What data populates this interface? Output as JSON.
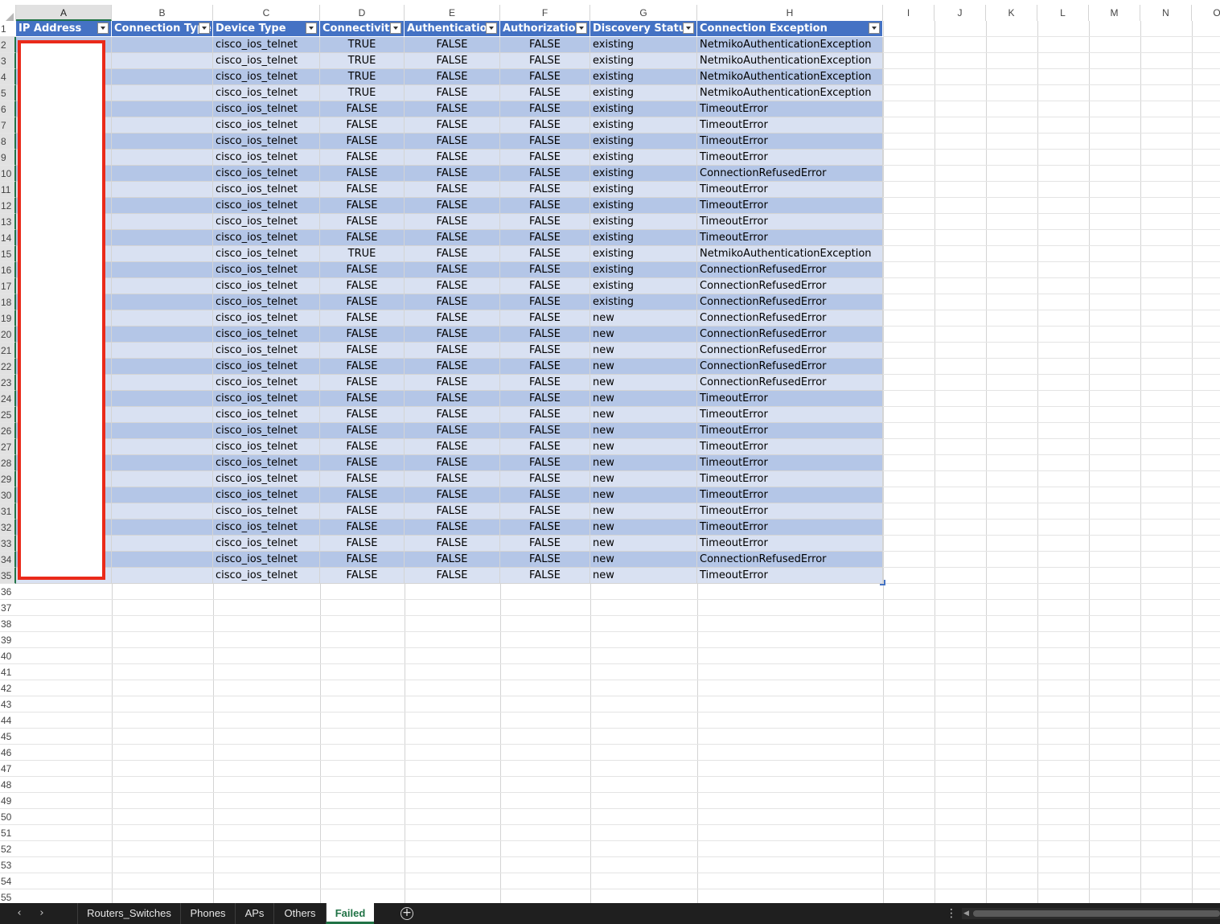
{
  "columns": [
    "A",
    "B",
    "C",
    "D",
    "E",
    "F",
    "G",
    "H",
    "I",
    "J",
    "K",
    "L",
    "M",
    "N",
    "O"
  ],
  "active_column": "A",
  "header_row": [
    "IP Address",
    "Connection Type",
    "Device Type",
    "Connectivity",
    "Authentication",
    "Authorization",
    "Discovery Status",
    "Connection Exception"
  ],
  "rows": [
    [
      "",
      "",
      "cisco_ios_telnet",
      "TRUE",
      "FALSE",
      "FALSE",
      "existing",
      "NetmikoAuthenticationException"
    ],
    [
      "",
      "",
      "cisco_ios_telnet",
      "TRUE",
      "FALSE",
      "FALSE",
      "existing",
      "NetmikoAuthenticationException"
    ],
    [
      "",
      "",
      "cisco_ios_telnet",
      "TRUE",
      "FALSE",
      "FALSE",
      "existing",
      "NetmikoAuthenticationException"
    ],
    [
      "",
      "",
      "cisco_ios_telnet",
      "TRUE",
      "FALSE",
      "FALSE",
      "existing",
      "NetmikoAuthenticationException"
    ],
    [
      "",
      "",
      "cisco_ios_telnet",
      "FALSE",
      "FALSE",
      "FALSE",
      "existing",
      "TimeoutError"
    ],
    [
      "",
      "",
      "cisco_ios_telnet",
      "FALSE",
      "FALSE",
      "FALSE",
      "existing",
      "TimeoutError"
    ],
    [
      "",
      "",
      "cisco_ios_telnet",
      "FALSE",
      "FALSE",
      "FALSE",
      "existing",
      "TimeoutError"
    ],
    [
      "",
      "",
      "cisco_ios_telnet",
      "FALSE",
      "FALSE",
      "FALSE",
      "existing",
      "TimeoutError"
    ],
    [
      "",
      "",
      "cisco_ios_telnet",
      "FALSE",
      "FALSE",
      "FALSE",
      "existing",
      "ConnectionRefusedError"
    ],
    [
      "",
      "",
      "cisco_ios_telnet",
      "FALSE",
      "FALSE",
      "FALSE",
      "existing",
      "TimeoutError"
    ],
    [
      "",
      "",
      "cisco_ios_telnet",
      "FALSE",
      "FALSE",
      "FALSE",
      "existing",
      "TimeoutError"
    ],
    [
      "",
      "",
      "cisco_ios_telnet",
      "FALSE",
      "FALSE",
      "FALSE",
      "existing",
      "TimeoutError"
    ],
    [
      "",
      "",
      "cisco_ios_telnet",
      "FALSE",
      "FALSE",
      "FALSE",
      "existing",
      "TimeoutError"
    ],
    [
      "",
      "",
      "cisco_ios_telnet",
      "TRUE",
      "FALSE",
      "FALSE",
      "existing",
      "NetmikoAuthenticationException"
    ],
    [
      "",
      "",
      "cisco_ios_telnet",
      "FALSE",
      "FALSE",
      "FALSE",
      "existing",
      "ConnectionRefusedError"
    ],
    [
      "",
      "",
      "cisco_ios_telnet",
      "FALSE",
      "FALSE",
      "FALSE",
      "existing",
      "ConnectionRefusedError"
    ],
    [
      "",
      "",
      "cisco_ios_telnet",
      "FALSE",
      "FALSE",
      "FALSE",
      "existing",
      "ConnectionRefusedError"
    ],
    [
      "",
      "",
      "cisco_ios_telnet",
      "FALSE",
      "FALSE",
      "FALSE",
      "new",
      "ConnectionRefusedError"
    ],
    [
      "",
      "",
      "cisco_ios_telnet",
      "FALSE",
      "FALSE",
      "FALSE",
      "new",
      "ConnectionRefusedError"
    ],
    [
      "",
      "",
      "cisco_ios_telnet",
      "FALSE",
      "FALSE",
      "FALSE",
      "new",
      "ConnectionRefusedError"
    ],
    [
      "",
      "",
      "cisco_ios_telnet",
      "FALSE",
      "FALSE",
      "FALSE",
      "new",
      "ConnectionRefusedError"
    ],
    [
      "",
      "",
      "cisco_ios_telnet",
      "FALSE",
      "FALSE",
      "FALSE",
      "new",
      "ConnectionRefusedError"
    ],
    [
      "",
      "",
      "cisco_ios_telnet",
      "FALSE",
      "FALSE",
      "FALSE",
      "new",
      "TimeoutError"
    ],
    [
      "",
      "",
      "cisco_ios_telnet",
      "FALSE",
      "FALSE",
      "FALSE",
      "new",
      "TimeoutError"
    ],
    [
      "",
      "",
      "cisco_ios_telnet",
      "FALSE",
      "FALSE",
      "FALSE",
      "new",
      "TimeoutError"
    ],
    [
      "",
      "",
      "cisco_ios_telnet",
      "FALSE",
      "FALSE",
      "FALSE",
      "new",
      "TimeoutError"
    ],
    [
      "",
      "",
      "cisco_ios_telnet",
      "FALSE",
      "FALSE",
      "FALSE",
      "new",
      "TimeoutError"
    ],
    [
      "",
      "",
      "cisco_ios_telnet",
      "FALSE",
      "FALSE",
      "FALSE",
      "new",
      "TimeoutError"
    ],
    [
      "",
      "",
      "cisco_ios_telnet",
      "FALSE",
      "FALSE",
      "FALSE",
      "new",
      "TimeoutError"
    ],
    [
      "",
      "",
      "cisco_ios_telnet",
      "FALSE",
      "FALSE",
      "FALSE",
      "new",
      "TimeoutError"
    ],
    [
      "",
      "",
      "cisco_ios_telnet",
      "FALSE",
      "FALSE",
      "FALSE",
      "new",
      "TimeoutError"
    ],
    [
      "",
      "",
      "cisco_ios_telnet",
      "FALSE",
      "FALSE",
      "FALSE",
      "new",
      "TimeoutError"
    ],
    [
      "",
      "",
      "cisco_ios_telnet",
      "FALSE",
      "FALSE",
      "FALSE",
      "new",
      "ConnectionRefusedError"
    ],
    [
      "",
      "",
      "cisco_ios_telnet",
      "FALSE",
      "FALSE",
      "FALSE",
      "new",
      "TimeoutError"
    ]
  ],
  "visible_row_count": 55,
  "sheet_tabs": [
    "Routers_Switches",
    "Phones",
    "APs",
    "Others",
    "Failed"
  ],
  "active_sheet": "Failed",
  "colors": {
    "table_header": "#4472c4",
    "band_dark": "#b4c6e7",
    "band_light": "#d9e1f2",
    "selection_outline": "#ea2a1a",
    "excel_green": "#217346",
    "tabbar_bg": "#1f1f1f"
  },
  "icons": {
    "filter": "filter-dropdown-icon",
    "nav_prev": "chevron-left-icon",
    "nav_next": "chevron-right-icon",
    "add_sheet": "plus-circle-icon",
    "more": "vertical-ellipsis-icon"
  }
}
